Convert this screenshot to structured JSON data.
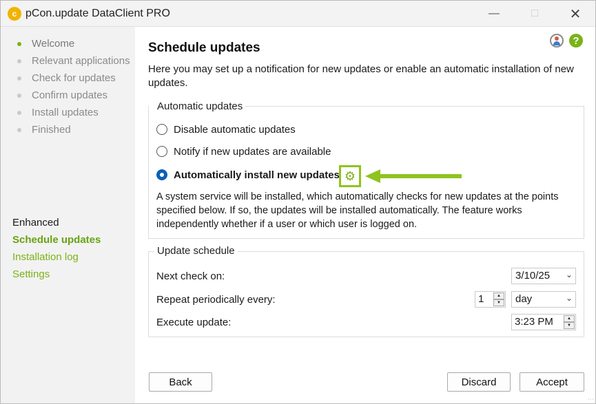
{
  "window": {
    "title": "pCon.update DataClient PRO",
    "app_icon": "pcon-logo-icon",
    "controls": [
      "minimize",
      "maximize",
      "close"
    ]
  },
  "sidebar": {
    "steps": [
      {
        "label": "Welcome",
        "active": true
      },
      {
        "label": "Relevant applications",
        "active": false
      },
      {
        "label": "Check for updates",
        "active": false
      },
      {
        "label": "Confirm updates",
        "active": false
      },
      {
        "label": "Install updates",
        "active": false
      },
      {
        "label": "Finished",
        "active": false
      }
    ],
    "enhanced_heading": "Enhanced",
    "links": [
      {
        "label": "Schedule updates",
        "current": true
      },
      {
        "label": "Installation log",
        "current": false
      },
      {
        "label": "Settings",
        "current": false
      }
    ]
  },
  "main": {
    "title": "Schedule updates",
    "intro": "Here you may set up a notification for new updates or enable an automatic installation of new updates.",
    "automatic_updates": {
      "title": "Automatic updates",
      "options": [
        {
          "label": "Disable automatic updates",
          "checked": false
        },
        {
          "label": "Notify if new updates are available",
          "checked": false
        },
        {
          "label": "Automatically install new updates",
          "checked": true
        }
      ],
      "description": "A system service will be installed, which automatically checks for new updates at the points specified below. If so, the updates will be installed automatically. The feature works independently whether if a user or which user is logged on."
    },
    "update_schedule": {
      "title": "Update schedule",
      "next_check_label": "Next check on:",
      "next_check_value": "3/10/25",
      "repeat_label": "Repeat periodically every:",
      "repeat_count": "1",
      "repeat_unit": "day",
      "execute_label": "Execute update:",
      "execute_time": "3:23 PM"
    }
  },
  "buttons": {
    "back": "Back",
    "discard": "Discard",
    "accept": "Accept"
  },
  "colors": {
    "accent_green": "#7ab317",
    "radio_blue": "#0a5fb8",
    "sidebar_bg": "#f2f2f2"
  }
}
